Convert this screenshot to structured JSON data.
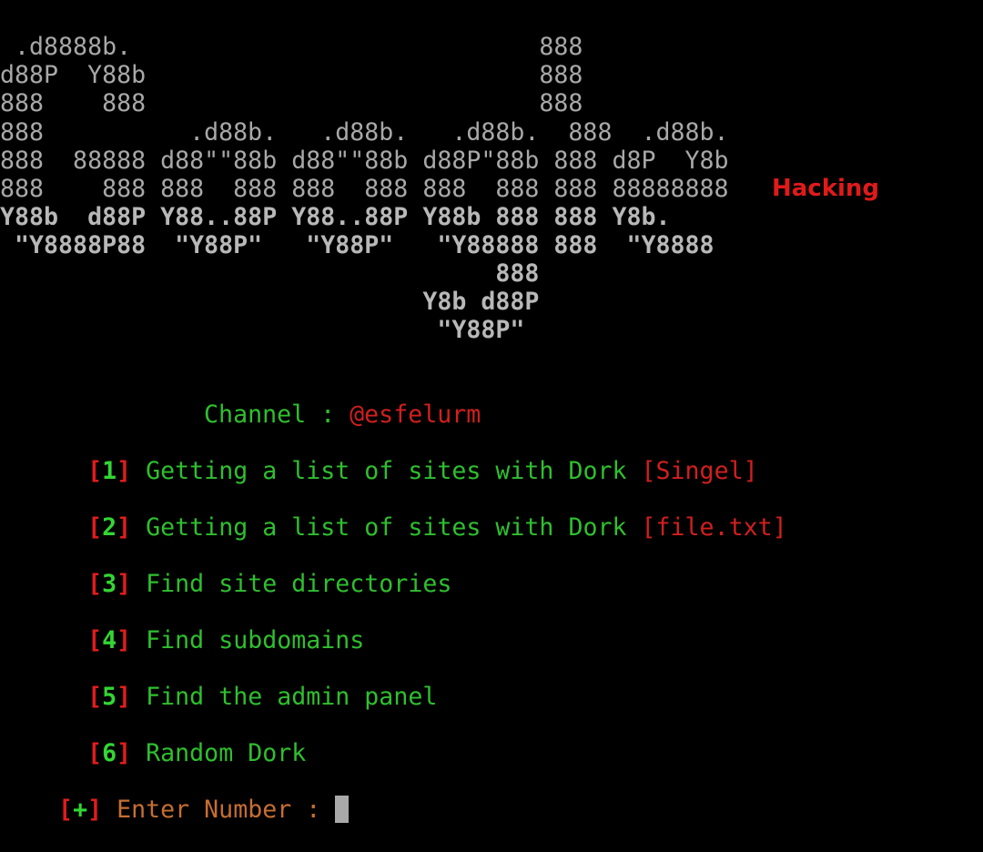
{
  "banner": {
    "lines": [
      " .d8888b.                            888",
      "d88P  Y88b                           888",
      "888    888                           888",
      "888          .d88b.   .d88b.   .d88b.  888  .d88b.",
      "888  88888 d88\"\"88b d88\"\"88b d88P\"88b 888 d8P  Y8b",
      "888    888 888  888 888  888 888  888 888 88888888",
      "Y88b  d88P Y88..88P Y88..88P Y88b 888 888 Y8b.",
      " \"Y8888P88  \"Y88P\"   \"Y88P\"   \"Y88888 888  \"Y8888",
      "                                  888",
      "                             Y8b d88P",
      "                              \"Y88P\""
    ],
    "tag": "Hacking"
  },
  "channel": {
    "label": "Channel : ",
    "handle": "@esfelurm"
  },
  "menu": [
    {
      "open": "[",
      "key": "1",
      "close": "]",
      "text": " Getting a list of sites with Dork ",
      "extra": "[Singel]"
    },
    {
      "open": "[",
      "key": "2",
      "close": "]",
      "text": " Getting a list of sites with Dork ",
      "extra": "[file.txt]"
    },
    {
      "open": "[",
      "key": "3",
      "close": "]",
      "text": " Find site directories",
      "extra": ""
    },
    {
      "open": "[",
      "key": "4",
      "close": "]",
      "text": " Find subdomains",
      "extra": ""
    },
    {
      "open": "[",
      "key": "5",
      "close": "]",
      "text": " Find the admin panel",
      "extra": ""
    },
    {
      "open": "[",
      "key": "6",
      "close": "]",
      "text": " Random Dork",
      "extra": ""
    }
  ],
  "prompt": {
    "open": "[",
    "symbol": "+",
    "close": "]",
    "label": " Enter Number : ",
    "value": ""
  }
}
